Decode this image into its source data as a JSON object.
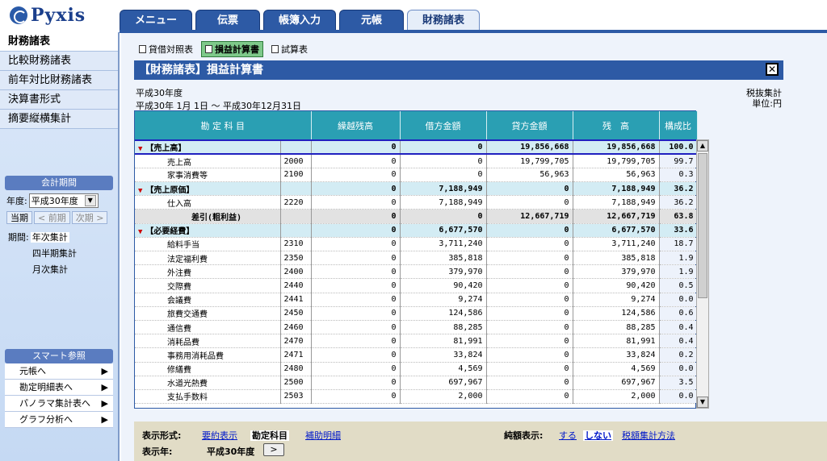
{
  "app": {
    "logo_text": "Pyxis",
    "brand_color": "#2d5aa5"
  },
  "tabs": [
    {
      "label": "メニュー"
    },
    {
      "label": "伝票"
    },
    {
      "label": "帳簿入力"
    },
    {
      "label": "元帳"
    },
    {
      "label": "財務諸表"
    }
  ],
  "sidebar": {
    "items": [
      {
        "label": "財務諸表"
      },
      {
        "label": "比較財務諸表"
      },
      {
        "label": "前年対比財務諸表"
      },
      {
        "label": "決算書形式"
      },
      {
        "label": "摘要縦横集計"
      }
    ],
    "period_title": "会計期間",
    "year_label": "年度:",
    "year_value": "平成30年度",
    "btn_current": "当期",
    "btn_prev": "< 前期",
    "btn_next": "次期 >",
    "period_label": "期間:",
    "period_options": [
      "年次集計",
      "四半期集計",
      "月次集計"
    ],
    "smart_title": "スマート参照",
    "smart_items": [
      "元帳へ",
      "勘定明細表へ",
      "パノラマ集計表へ",
      "グラフ分析へ"
    ]
  },
  "subtabs": [
    {
      "label": "貸借対照表"
    },
    {
      "label": "損益計算書"
    },
    {
      "label": "試算表"
    }
  ],
  "title": "【財務諸表】損益計算書",
  "info": {
    "year": "平成30年度",
    "range": "平成30年 1月 1日 ～ 平成30年12月31日",
    "tax": "税抜集計",
    "unit": "単位:円"
  },
  "table": {
    "headers": [
      "勘 定 科 目",
      "繰越残高",
      "借方金額",
      "貸方金額",
      "残　高",
      "構成比"
    ],
    "rows": [
      {
        "type": "group",
        "name": "【売上高】",
        "code": "",
        "carry": "0",
        "debit": "0",
        "credit": "19,856,668",
        "balance": "19,856,668",
        "ratio": "100.0"
      },
      {
        "type": "item",
        "name": "売上高",
        "code": "2000",
        "carry": "0",
        "debit": "0",
        "credit": "19,799,705",
        "balance": "19,799,705",
        "ratio": "99.7"
      },
      {
        "type": "item",
        "name": "家事消費等",
        "code": "2100",
        "carry": "0",
        "debit": "0",
        "credit": "56,963",
        "balance": "56,963",
        "ratio": "0.3"
      },
      {
        "type": "group",
        "name": "【売上原価】",
        "code": "",
        "carry": "0",
        "debit": "7,188,949",
        "credit": "0",
        "balance": "7,188,949",
        "ratio": "36.2"
      },
      {
        "type": "item",
        "name": "仕入高",
        "code": "2220",
        "carry": "0",
        "debit": "7,188,949",
        "credit": "0",
        "balance": "7,188,949",
        "ratio": "36.2"
      },
      {
        "type": "sub",
        "name": "差引(粗利益)",
        "code": "",
        "carry": "0",
        "debit": "0",
        "credit": "12,667,719",
        "balance": "12,667,719",
        "ratio": "63.8"
      },
      {
        "type": "group",
        "name": "【必要経費】",
        "code": "",
        "carry": "0",
        "debit": "6,677,570",
        "credit": "0",
        "balance": "6,677,570",
        "ratio": "33.6"
      },
      {
        "type": "item",
        "name": "給料手当",
        "code": "2310",
        "carry": "0",
        "debit": "3,711,240",
        "credit": "0",
        "balance": "3,711,240",
        "ratio": "18.7"
      },
      {
        "type": "item",
        "name": "法定福利費",
        "code": "2350",
        "carry": "0",
        "debit": "385,818",
        "credit": "0",
        "balance": "385,818",
        "ratio": "1.9"
      },
      {
        "type": "item",
        "name": "外注費",
        "code": "2400",
        "carry": "0",
        "debit": "379,970",
        "credit": "0",
        "balance": "379,970",
        "ratio": "1.9"
      },
      {
        "type": "item",
        "name": "交際費",
        "code": "2440",
        "carry": "0",
        "debit": "90,420",
        "credit": "0",
        "balance": "90,420",
        "ratio": "0.5"
      },
      {
        "type": "item",
        "name": "会議費",
        "code": "2441",
        "carry": "0",
        "debit": "9,274",
        "credit": "0",
        "balance": "9,274",
        "ratio": "0.0"
      },
      {
        "type": "item",
        "name": "旅費交通費",
        "code": "2450",
        "carry": "0",
        "debit": "124,586",
        "credit": "0",
        "balance": "124,586",
        "ratio": "0.6"
      },
      {
        "type": "item",
        "name": "通信費",
        "code": "2460",
        "carry": "0",
        "debit": "88,285",
        "credit": "0",
        "balance": "88,285",
        "ratio": "0.4"
      },
      {
        "type": "item",
        "name": "消耗品費",
        "code": "2470",
        "carry": "0",
        "debit": "81,991",
        "credit": "0",
        "balance": "81,991",
        "ratio": "0.4"
      },
      {
        "type": "item",
        "name": "事務用消耗品費",
        "code": "2471",
        "carry": "0",
        "debit": "33,824",
        "credit": "0",
        "balance": "33,824",
        "ratio": "0.2"
      },
      {
        "type": "item",
        "name": "修繕費",
        "code": "2480",
        "carry": "0",
        "debit": "4,569",
        "credit": "0",
        "balance": "4,569",
        "ratio": "0.0"
      },
      {
        "type": "item",
        "name": "水道光熱費",
        "code": "2500",
        "carry": "0",
        "debit": "697,967",
        "credit": "0",
        "balance": "697,967",
        "ratio": "3.5"
      },
      {
        "type": "item",
        "name": "支払手数料",
        "code": "2503",
        "carry": "0",
        "debit": "2,000",
        "credit": "0",
        "balance": "2,000",
        "ratio": "0.0"
      }
    ]
  },
  "footer": {
    "display_label": "表示形式:",
    "opt_summary": "要約表示",
    "opt_account": "勘定科目",
    "opt_sub": "補助明細",
    "year_label": "表示年:",
    "year_value": "平成30年度",
    "year_btn": ">",
    "amount_label": "純額表示:",
    "amount_yes": "する",
    "amount_no": "しない",
    "tax_method": "税額集計方法"
  }
}
